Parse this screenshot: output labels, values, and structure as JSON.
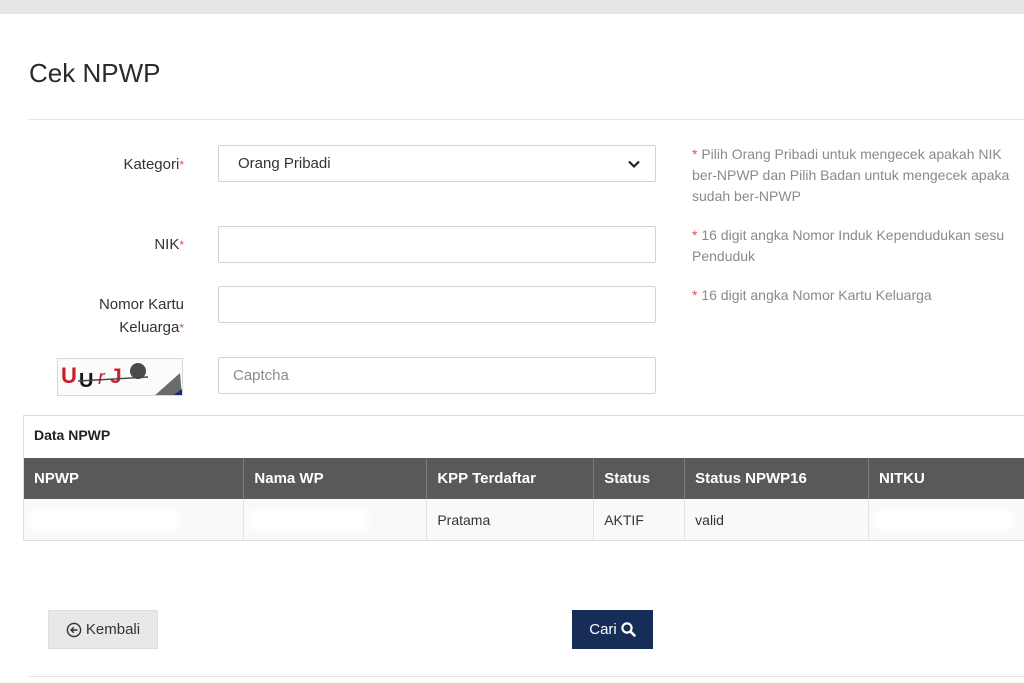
{
  "page": {
    "title": "Cek NPWP"
  },
  "form": {
    "kategori": {
      "label": "Kategori",
      "required_mark": "*",
      "selected": "Orang Pribadi",
      "hint_lines": [
        "Pilih Orang Pribadi untuk mengecek apakah NIK",
        "ber-NPWP dan Pilih Badan untuk mengecek apaka",
        "sudah ber-NPWP"
      ]
    },
    "nik": {
      "label": "NIK",
      "required_mark": "*",
      "value": "",
      "hint_lines": [
        "16 digit angka Nomor Induk Kependudukan sesu",
        "Penduduk"
      ]
    },
    "kk": {
      "label_line1": "Nomor Kartu",
      "label_line2": "Keluarga",
      "required_mark": "*",
      "value": "",
      "hint_lines": [
        "16 digit angka Nomor Kartu Keluarga"
      ]
    },
    "captcha": {
      "image_text": "UUrJ",
      "placeholder": "Captcha"
    }
  },
  "table": {
    "caption": "Data NPWP",
    "headers": [
      "NPWP",
      "Nama WP",
      "KPP Terdaftar",
      "Status",
      "Status NPWP16",
      "NITKU"
    ],
    "rows": [
      {
        "npwp": "",
        "nama_wp": "",
        "kpp": "Pratama",
        "status": "AKTIF",
        "status_npwp16": "valid",
        "nitku": ""
      }
    ]
  },
  "buttons": {
    "back_label": "Kembali",
    "search_label": "Cari"
  },
  "colors": {
    "primary_button": "#162d58",
    "table_header": "#58595b",
    "required": "#d9534f"
  },
  "icons": {
    "back": "circle-arrow-left-icon",
    "search": "magnifier-icon",
    "select": "chevron-down-icon"
  }
}
